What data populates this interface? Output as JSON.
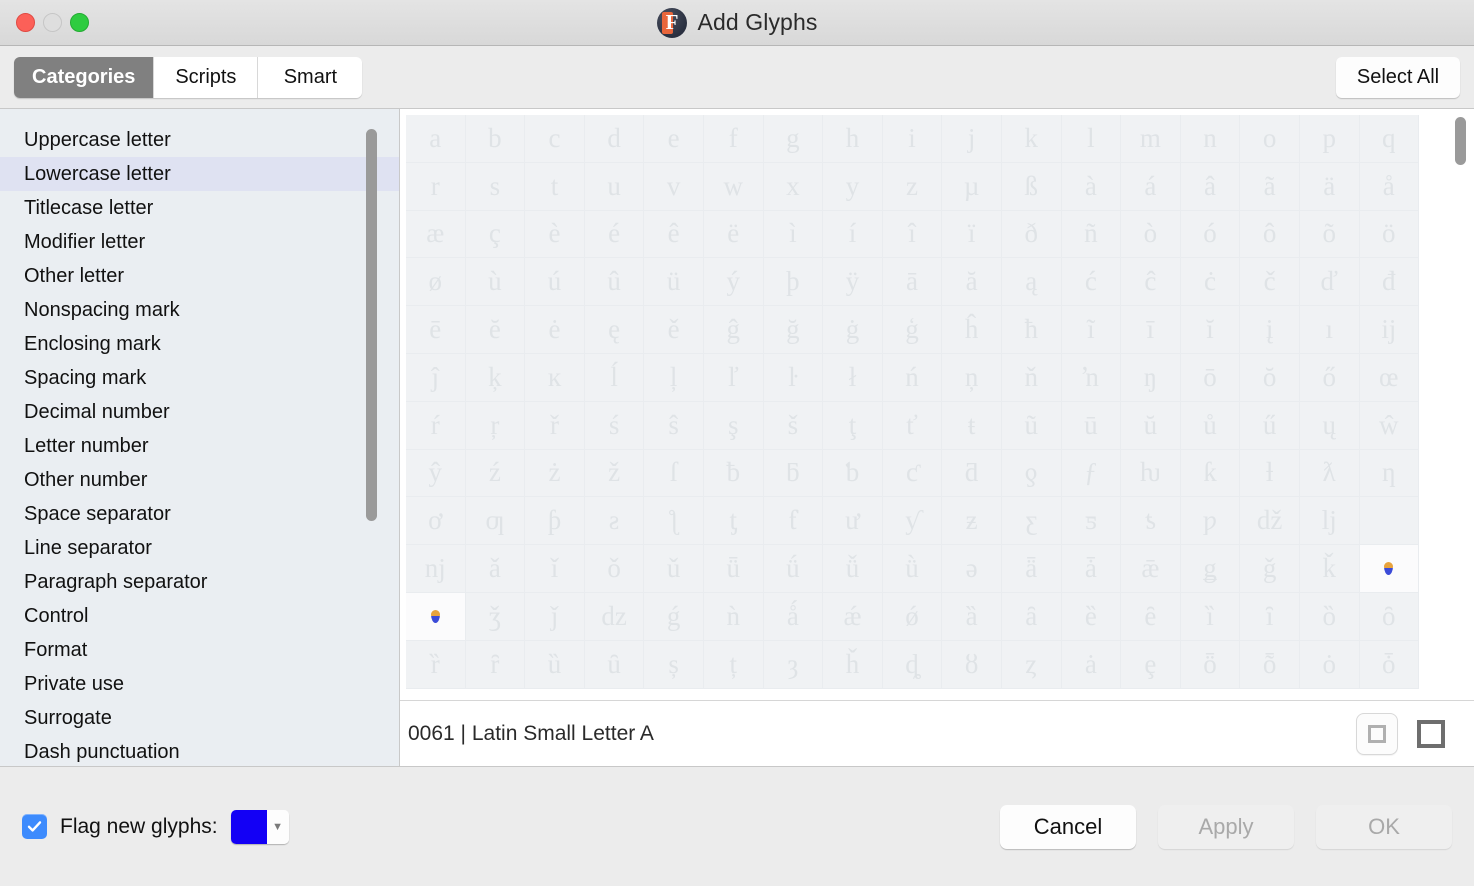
{
  "window": {
    "title": "Add Glyphs",
    "app_icon": "fontlab-app-icon",
    "traffic_lights": [
      {
        "name": "close-button",
        "color": "#fc6058"
      },
      {
        "name": "minimize-button",
        "color": "#dedede"
      },
      {
        "name": "zoom-button",
        "color": "#2ecc40"
      }
    ]
  },
  "toolbar": {
    "tabs": [
      {
        "label": "Categories",
        "active": true
      },
      {
        "label": "Scripts",
        "active": false
      },
      {
        "label": "Smart",
        "active": false
      }
    ],
    "select_all_label": "Select All"
  },
  "sidebar": {
    "selected_index": 1,
    "items": [
      {
        "label": "Uppercase letter"
      },
      {
        "label": "Lowercase letter"
      },
      {
        "label": "Titlecase letter"
      },
      {
        "label": "Modifier letter"
      },
      {
        "label": "Other letter"
      },
      {
        "label": "Nonspacing mark"
      },
      {
        "label": "Enclosing mark"
      },
      {
        "label": "Spacing mark"
      },
      {
        "label": "Decimal number"
      },
      {
        "label": "Letter number"
      },
      {
        "label": "Other number"
      },
      {
        "label": "Space separator"
      },
      {
        "label": "Line separator"
      },
      {
        "label": "Paragraph separator"
      },
      {
        "label": "Control"
      },
      {
        "label": "Format"
      },
      {
        "label": "Private use"
      },
      {
        "label": "Surrogate"
      },
      {
        "label": "Dash punctuation"
      }
    ]
  },
  "glyph_grid": {
    "columns": 17,
    "rows": [
      [
        "a",
        "b",
        "c",
        "d",
        "e",
        "f",
        "g",
        "h",
        "i",
        "j",
        "k",
        "l",
        "m",
        "n",
        "o",
        "p",
        "q"
      ],
      [
        "r",
        "s",
        "t",
        "u",
        "v",
        "w",
        "x",
        "y",
        "z",
        "µ",
        "ß",
        "à",
        "á",
        "â",
        "ã",
        "ä",
        "å"
      ],
      [
        "æ",
        "ç",
        "è",
        "é",
        "ê",
        "ë",
        "ì",
        "í",
        "î",
        "ï",
        "ð",
        "ñ",
        "ò",
        "ó",
        "ô",
        "õ",
        "ö"
      ],
      [
        "ø",
        "ù",
        "ú",
        "û",
        "ü",
        "ý",
        "þ",
        "ÿ",
        "ā",
        "ă",
        "ą",
        "ć",
        "ĉ",
        "ċ",
        "č",
        "ď",
        "đ"
      ],
      [
        "ē",
        "ĕ",
        "ė",
        "ę",
        "ě",
        "ĝ",
        "ğ",
        "ġ",
        "ģ",
        "ĥ",
        "ħ",
        "ĩ",
        "ī",
        "ĭ",
        "į",
        "ı",
        "ĳ"
      ],
      [
        "ĵ",
        "ķ",
        "ĸ",
        "ĺ",
        "ļ",
        "ľ",
        "ŀ",
        "ł",
        "ń",
        "ņ",
        "ň",
        "ŉ",
        "ŋ",
        "ō",
        "ŏ",
        "ő",
        "œ"
      ],
      [
        "ŕ",
        "ŗ",
        "ř",
        "ś",
        "ŝ",
        "ş",
        "š",
        "ţ",
        "ť",
        "ŧ",
        "ũ",
        "ū",
        "ŭ",
        "ů",
        "ű",
        "ų",
        "ŵ"
      ],
      [
        "ŷ",
        "ź",
        "ż",
        "ž",
        "ſ",
        "ƀ",
        "ƃ",
        "ƅ",
        "ƈ",
        "ƌ",
        "ƍ",
        "ƒ",
        "ƕ",
        "ƙ",
        "ƚ",
        "ƛ",
        "ƞ"
      ],
      [
        "ơ",
        "ƣ",
        "ƥ",
        "ƨ",
        "ƪ",
        "ƫ",
        "ƭ",
        "ư",
        "ƴ",
        "ƶ",
        "ƹ",
        "ƽ",
        "ƾ",
        "ƿ",
        "ǆ",
        "ǉ",
        "\u0000"
      ],
      [
        "ǌ",
        "ǎ",
        "ǐ",
        "ǒ",
        "ǔ",
        "ǖ",
        "ǘ",
        "ǚ",
        "ǜ",
        "ǝ",
        "ǟ",
        "ǡ",
        "ǣ",
        "ǥ",
        "ǧ",
        "ǩ",
        "MARK"
      ],
      [
        "MARK",
        "ǯ",
        "ǰ",
        "ǳ",
        "ǵ",
        "ǹ",
        "ǻ",
        "ǽ",
        "ǿ",
        "ȁ",
        "ȃ",
        "ȅ",
        "ȇ",
        "ȉ",
        "ȋ",
        "ȍ",
        "ȏ"
      ],
      [
        "ȑ",
        "ȓ",
        "ȕ",
        "ȗ",
        "ș",
        "ț",
        "ȝ",
        "ȟ",
        "ȡ",
        "ȣ",
        "ȥ",
        "ȧ",
        "ȩ",
        "ȫ",
        "ȭ",
        "ȯ",
        "ȱ"
      ]
    ],
    "marked_token": "MARK",
    "marked_cells": [
      {
        "row": 9,
        "col": 16
      },
      {
        "row": 10,
        "col": 0
      }
    ]
  },
  "info_bar": {
    "codepoint": "0061",
    "separator": "|",
    "glyph_name": "Latin Small Letter A",
    "text": "0061 | Latin Small Letter A",
    "size_buttons": [
      {
        "name": "small-cell-size-button",
        "selected": true
      },
      {
        "name": "large-cell-size-button",
        "selected": false
      }
    ]
  },
  "bottom_bar": {
    "flag_checkbox_checked": true,
    "flag_label": "Flag new glyphs:",
    "flag_color": "#1300f5",
    "buttons": [
      {
        "label": "Cancel",
        "enabled": true
      },
      {
        "label": "Apply",
        "enabled": false
      },
      {
        "label": "OK",
        "enabled": false
      }
    ]
  }
}
